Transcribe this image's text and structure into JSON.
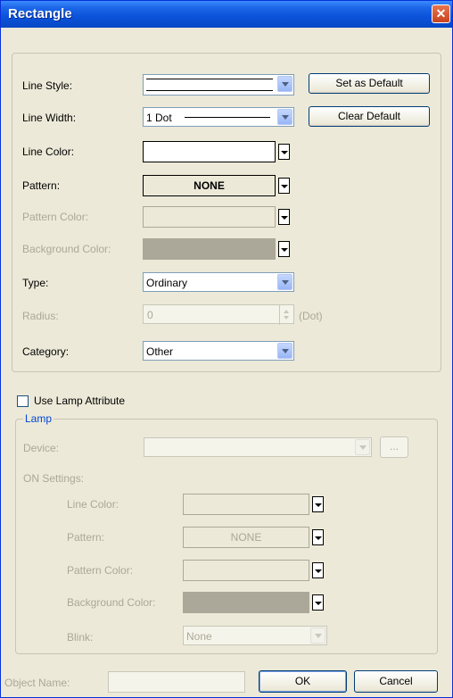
{
  "window": {
    "title": "Rectangle",
    "close_glyph": "✕"
  },
  "main": {
    "line_style": {
      "label": "Line Style:"
    },
    "line_width": {
      "label": "Line Width:",
      "value": "1 Dot"
    },
    "line_color": {
      "label": "Line Color:"
    },
    "pattern": {
      "label": "Pattern:",
      "value": "NONE"
    },
    "pattern_color": {
      "label": "Pattern Color:"
    },
    "background_color": {
      "label": "Background Color:"
    },
    "type": {
      "label": "Type:",
      "value": "Ordinary"
    },
    "radius": {
      "label": "Radius:",
      "value": "0",
      "unit": "(Dot)"
    },
    "category": {
      "label": "Category:",
      "value": "Other"
    },
    "set_default": "Set as Default",
    "clear_default": "Clear Default"
  },
  "lamp": {
    "use_label": "Use Lamp Attribute",
    "legend": "Lamp",
    "device_label": "Device:",
    "device_browse": "...",
    "on_settings_label": "ON Settings:",
    "line_color_label": "Line Color:",
    "pattern_label": "Pattern:",
    "pattern_value": "NONE",
    "pattern_color_label": "Pattern Color:",
    "background_color_label": "Background Color:",
    "blink_label": "Blink:",
    "blink_value": "None"
  },
  "footer": {
    "object_name_label": "Object Name:",
    "ok": "OK",
    "cancel": "Cancel"
  },
  "colors": {
    "title_bar": "#0a52d9",
    "dialog_bg": "#ece9d8",
    "close_button": "#c6431e",
    "lamp_legend": "#0046d5",
    "disabled_fill": "#aca899"
  }
}
